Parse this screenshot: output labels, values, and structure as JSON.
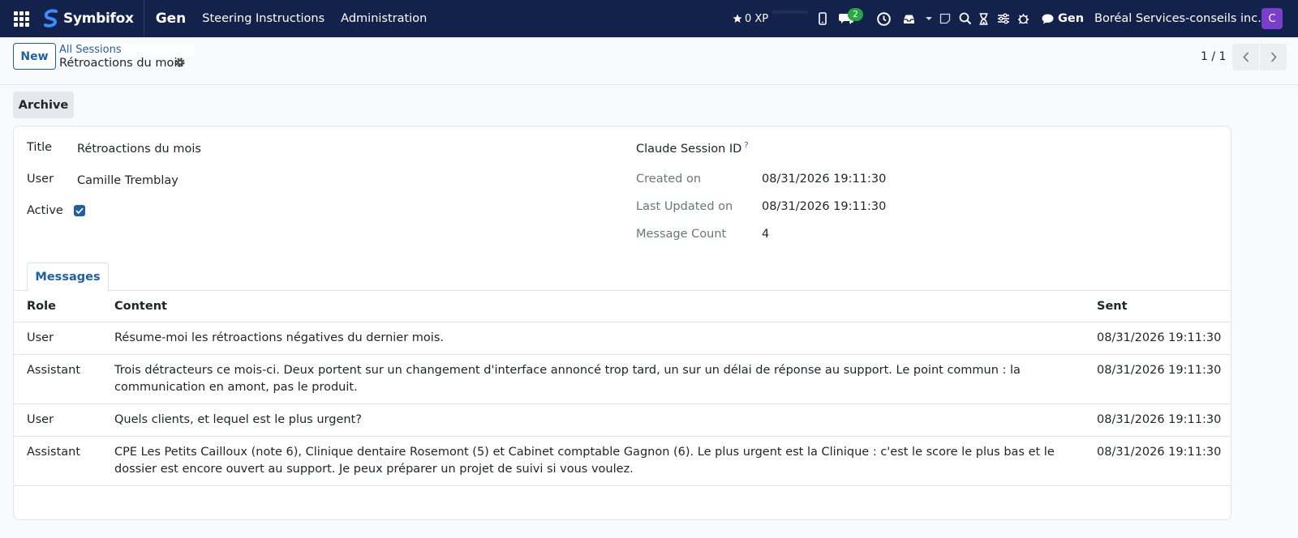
{
  "navbar": {
    "brand": "Symbifox",
    "app": "Gen",
    "menus": [
      "Steering Instructions",
      "Administration"
    ],
    "xp": "0 XP",
    "chat_badge": "2",
    "gen_chat": "Gen",
    "company": "Boréal Services-conseils inc.",
    "avatar_initial": "C",
    "icons": [
      "apps-grid-icon",
      "phone-icon",
      "chat-icon",
      "clock-icon",
      "inbox-icon",
      "caret-down-icon",
      "note-icon",
      "search-icon",
      "hourglass-icon",
      "sliders-icon",
      "bug-icon",
      "comment-icon"
    ]
  },
  "control": {
    "new_label": "New",
    "breadcrumb_parent": "All Sessions",
    "breadcrumb_current": "Rétroactions du mois",
    "pager": "1 / 1"
  },
  "actions": {
    "archive_label": "Archive"
  },
  "form": {
    "title_label": "Title",
    "title_value": "Rétroactions du mois",
    "user_label": "User",
    "user_value": "Camille Tremblay",
    "active_label": "Active",
    "active_value": true,
    "session_id_label": "Claude Session ID",
    "session_id_help": "?",
    "created_label": "Created on",
    "created_value": "08/31/2026 19:11:30",
    "updated_label": "Last Updated on",
    "updated_value": "08/31/2026 19:11:30",
    "count_label": "Message Count",
    "count_value": "4"
  },
  "tabs": {
    "messages": "Messages"
  },
  "table": {
    "headers": {
      "role": "Role",
      "content": "Content",
      "sent": "Sent"
    },
    "rows": [
      {
        "role": "User",
        "content": "Résume-moi les rétroactions négatives du dernier mois.",
        "sent": "08/31/2026 19:11:30"
      },
      {
        "role": "Assistant",
        "content": "Trois détracteurs ce mois-ci. Deux portent sur un changement d'interface annoncé trop tard, un sur un délai de réponse au support. Le point commun : la communication en amont, pas le produit.",
        "sent": "08/31/2026 19:11:30"
      },
      {
        "role": "User",
        "content": "Quels clients, et lequel est le plus urgent?",
        "sent": "08/31/2026 19:11:30"
      },
      {
        "role": "Assistant",
        "content": "CPE Les Petits Cailloux (note 6), Clinique dentaire Rosemont (5) et Cabinet comptable Gagnon (6). Le plus urgent est la Clinique : c'est le score le plus bas et le dossier est encore ouvert au support. Je peux préparer un projet de suivi si vous voulez.",
        "sent": "08/31/2026 19:11:30"
      }
    ]
  }
}
